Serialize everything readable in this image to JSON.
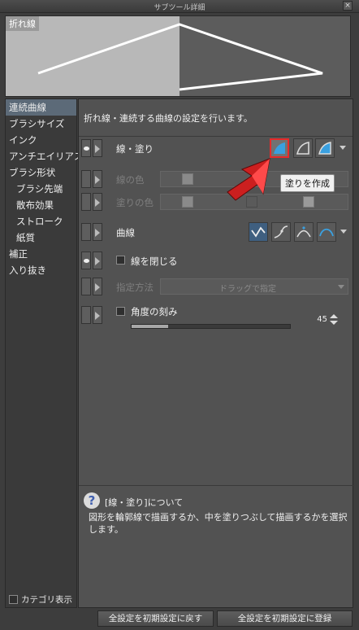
{
  "window": {
    "title": "サブツール詳細",
    "close": "×"
  },
  "preview": {
    "label": "折れ線"
  },
  "categories": [
    {
      "label": "連続曲線",
      "active": true,
      "sub": false
    },
    {
      "label": "ブラシサイズ",
      "sub": false
    },
    {
      "label": "インク",
      "sub": false
    },
    {
      "label": "アンチエイリアス",
      "sub": false
    },
    {
      "label": "ブラシ形状",
      "sub": false
    },
    {
      "label": "ブラシ先端",
      "sub": true
    },
    {
      "label": "散布効果",
      "sub": true
    },
    {
      "label": "ストローク",
      "sub": true
    },
    {
      "label": "紙質",
      "sub": true
    },
    {
      "label": "補正",
      "sub": false
    },
    {
      "label": "入り抜き",
      "sub": false
    }
  ],
  "category_footer": {
    "label": "カテゴリ表示",
    "checked": false
  },
  "main": {
    "description": "折れ線・連続する曲線の設定を行います。",
    "line_fill": {
      "label": "線・塗り",
      "tooltip": "塗りを作成"
    },
    "line_color": {
      "label": "線の色"
    },
    "fill_color": {
      "label": "塗りの色"
    },
    "curve": {
      "label": "曲線"
    },
    "close_line": {
      "label": "線を閉じる",
      "checked": false
    },
    "method": {
      "label": "指定方法",
      "value": "ドラッグで指定"
    },
    "angle_step": {
      "label": "角度の刻み",
      "value": "45",
      "fraction": 0.23
    }
  },
  "help": {
    "icon": "?",
    "title": "[線・塗り]について",
    "body": "図形を輪郭線で描画するか、中を塗りつぶして描画するかを選択します。"
  },
  "footer": {
    "reset_label": "全設定を初期設定に戻す",
    "register_label": "全設定を初期設定に登録"
  },
  "colors": {
    "accent_blue": "#3aa0e0",
    "selection_red": "#e82a2a",
    "panel": "#525252"
  }
}
